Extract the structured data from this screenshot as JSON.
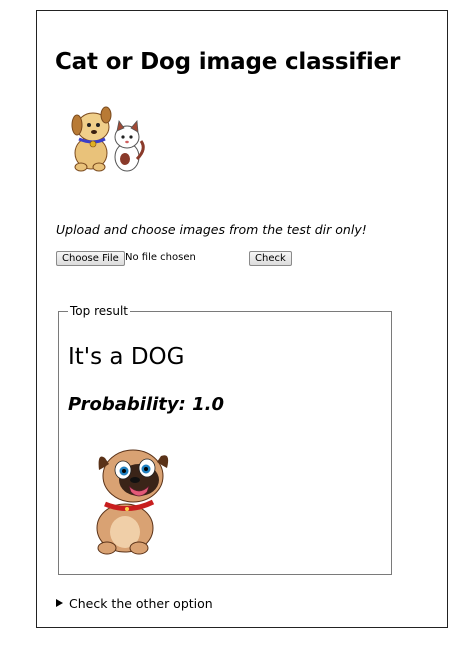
{
  "page": {
    "title": "Cat or Dog image classifier",
    "hero_image": "cat-and-dog-cartoon",
    "instructions": "Upload and choose images from the test dir only!"
  },
  "upload": {
    "choose_button": "Choose File",
    "file_status": "No file chosen",
    "check_button": "Check"
  },
  "result": {
    "legend": "Top result",
    "heading": "It's a DOG",
    "probability_label": "Probability:",
    "probability_value": "1.0",
    "image": "pug-puppy-cartoon"
  },
  "details": {
    "summary": "Check the other option"
  }
}
